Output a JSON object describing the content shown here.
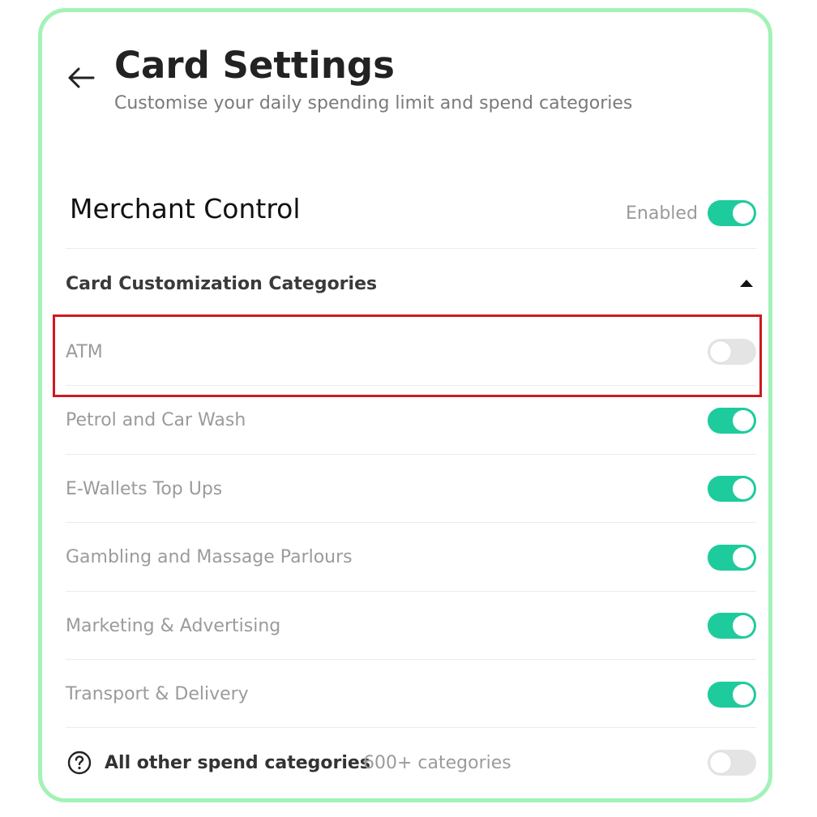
{
  "header": {
    "title": "Card Settings",
    "subtitle": "Customise your daily spending limit and spend categories"
  },
  "merchant_control": {
    "title": "Merchant Control",
    "status_label": "Enabled",
    "enabled": true
  },
  "categories_section": {
    "title": "Card Customization Categories",
    "expanded": true,
    "items": [
      {
        "label": "ATM",
        "enabled": false,
        "highlighted": true
      },
      {
        "label": "Petrol and Car Wash",
        "enabled": true
      },
      {
        "label": "E-Wallets Top Ups",
        "enabled": true
      },
      {
        "label": "Gambling and Massage Parlours",
        "enabled": true
      },
      {
        "label": "Marketing & Advertising",
        "enabled": true
      },
      {
        "label": "Transport & Delivery",
        "enabled": true
      }
    ]
  },
  "other_categories": {
    "label": "All other spend categories",
    "count": "600+ categories",
    "enabled": false
  },
  "icons": {
    "back": "arrow-left-icon",
    "caret": "caret-up-icon",
    "help": "question-circle-icon"
  },
  "colors": {
    "toggle_on": "#1ecb9c",
    "toggle_off": "#e4e4e4",
    "card_border": "#a3f2b6",
    "highlight_border": "#d0191f"
  }
}
